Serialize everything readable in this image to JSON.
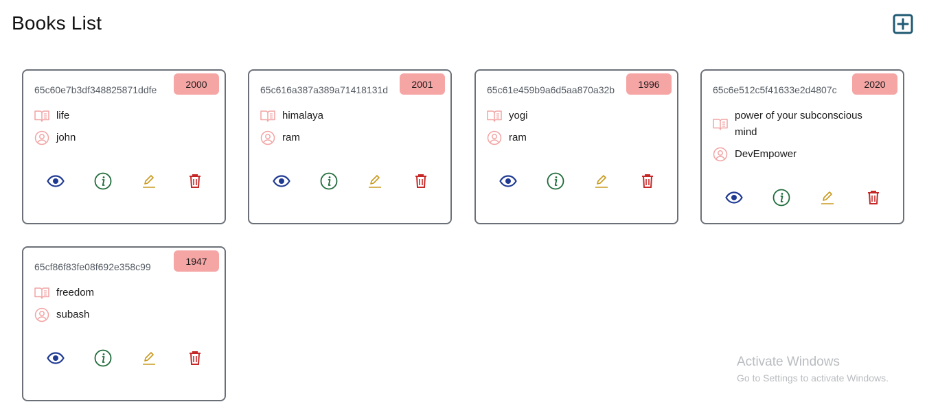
{
  "header": {
    "title": "Books List",
    "add_icon": "plus-square-icon"
  },
  "colors": {
    "badge_bg": "#f6a5a5",
    "view": "#1f3a93",
    "info": "#1e6b3a",
    "edit": "#c99a1e",
    "delete": "#c62828",
    "meta_icon": "#f2a4a4",
    "add": "#1f5a73"
  },
  "books": [
    {
      "id": "65c60e7b3df348825871ddfe",
      "year": "2000",
      "title": "life",
      "author": "john"
    },
    {
      "id": "65c616a387a389a71418131d",
      "year": "2001",
      "title": "himalaya",
      "author": "ram"
    },
    {
      "id": "65c61e459b9a6d5aa870a32b",
      "year": "1996",
      "title": "yogi",
      "author": "ram"
    },
    {
      "id": "65c6e512c5f41633e2d4807c",
      "year": "2020",
      "title": "power of your subconscious mind",
      "author": "DevEmpower"
    },
    {
      "id": "65cf86f83fe08f692e358c99",
      "year": "1947",
      "title": "freedom",
      "author": "subash"
    }
  ],
  "actions": {
    "icons": [
      "eye-icon",
      "info-icon",
      "pencil-icon",
      "trash-icon"
    ]
  },
  "watermark": {
    "line1": "Activate Windows",
    "line2": "Go to Settings to activate Windows."
  }
}
